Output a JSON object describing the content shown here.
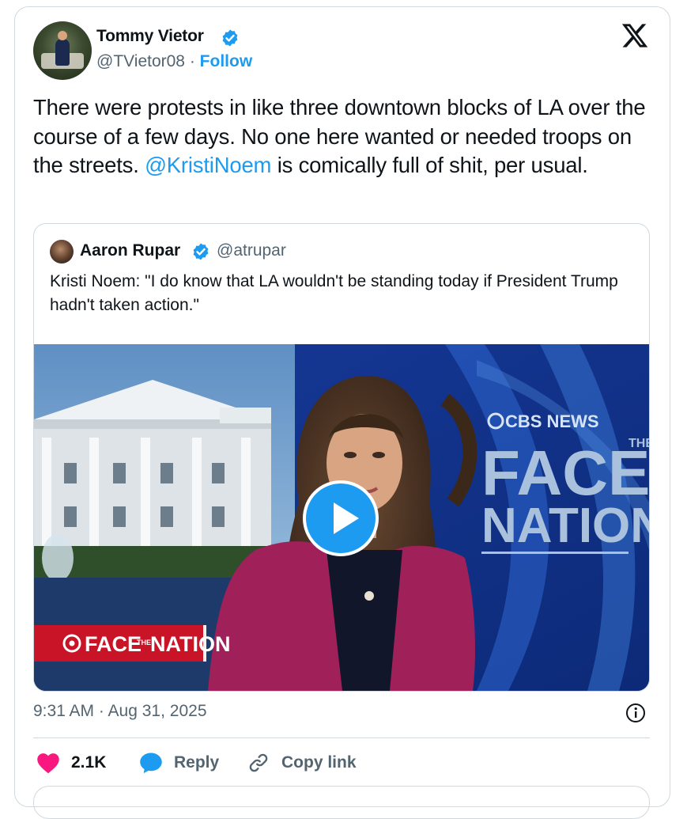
{
  "author": {
    "name": "Tommy Vietor",
    "handle": "@TVietor08",
    "separator": "·",
    "follow_label": "Follow"
  },
  "tweet": {
    "text_part1": "There were protests in like three downtown blocks of LA over the course of a few days. No one here wanted or needed troops on the streets. ",
    "mention": "@KristiNoem",
    "text_part2": " is comically full of shit, per usual."
  },
  "quoted": {
    "name": "Aaron Rupar",
    "handle": "@atrupar",
    "text": "Kristi Noem: \"I do know that LA wouldn't be standing today if President Trump hadn't taken action.\"",
    "video": {
      "network_logo": "CBS NEWS",
      "show_title_main1": "FACE",
      "show_title_main2": "NATION",
      "show_title_the": "THE",
      "lower_third": "FACE",
      "lower_third_the": "THE",
      "lower_third_2": "NATION"
    }
  },
  "timestamp": "9:31 AM · Aug 31, 2025",
  "actions": {
    "likes": "2.1K",
    "reply": "Reply",
    "copy_link": "Copy link"
  },
  "colors": {
    "accent": "#1d9bf0",
    "like": "#f91880",
    "text": "#0f1419",
    "muted": "#536471"
  },
  "icons": [
    "verified-badge-icon",
    "x-logo-icon",
    "play-icon",
    "info-icon",
    "heart-icon",
    "reply-bubble-icon",
    "link-icon"
  ]
}
